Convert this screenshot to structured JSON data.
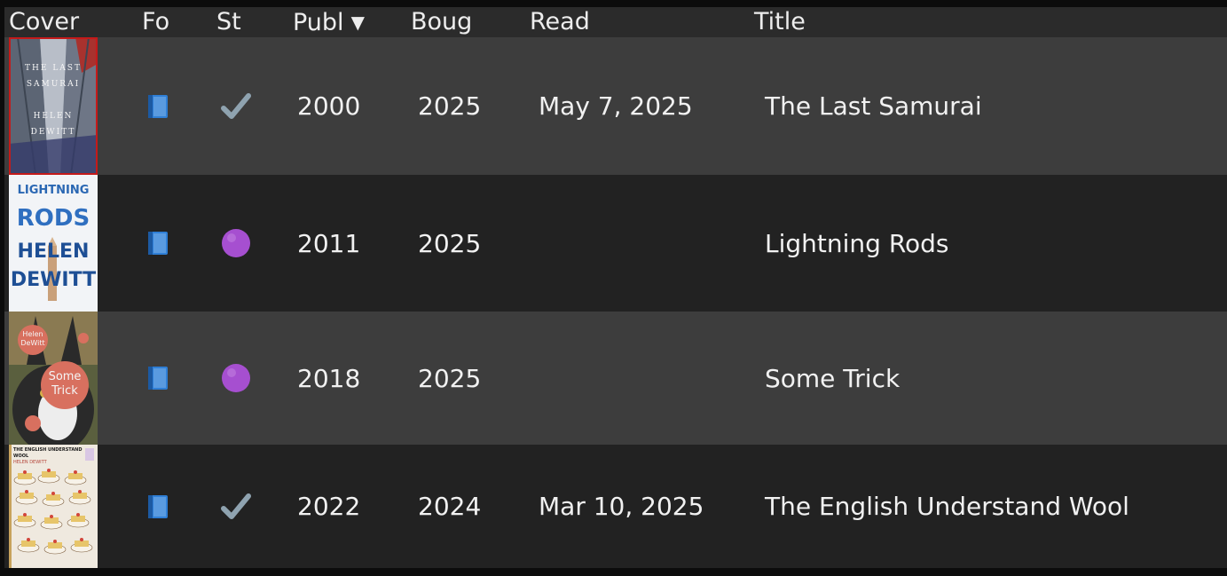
{
  "columns": {
    "cover": "Cover",
    "format": "Fo",
    "status": "St",
    "published": "Publ",
    "published_sort": "▼",
    "bought": "Boug",
    "read": "Read",
    "title": "Title"
  },
  "rows": [
    {
      "published": "2000",
      "bought": "2025",
      "read": "May 7, 2025",
      "title": "The Last Samurai",
      "format_icon": "blue-book",
      "status_icon": "check-mark",
      "cover_text": [
        "THE LAST",
        "SAMURAI",
        "HELEN",
        "DEWITT"
      ]
    },
    {
      "published": "2011",
      "bought": "2025",
      "read": "",
      "title": "Lightning Rods",
      "format_icon": "blue-book",
      "status_icon": "purple-circle",
      "cover_text": [
        "LIGHTNING",
        "RODS",
        "HELEN",
        "DEWITT"
      ]
    },
    {
      "published": "2018",
      "bought": "2025",
      "read": "",
      "title": "Some Trick",
      "format_icon": "blue-book",
      "status_icon": "purple-circle",
      "cover_text": [
        "Helen",
        "DeWitt",
        "Some",
        "Trick"
      ]
    },
    {
      "published": "2022",
      "bought": "2024",
      "read": "Mar 10, 2025",
      "title": "The English Understand Wool",
      "format_icon": "blue-book",
      "status_icon": "check-mark",
      "cover_text": [
        "THE ENGLISH UNDERSTAND",
        "WOOL",
        "HELEN DEWITT"
      ]
    }
  ],
  "colors": {
    "header_bg": "#2b2b2b",
    "row_light": "#3d3d3d",
    "row_dark": "#222222",
    "selection": "#c41a1a",
    "book_blue": "#2f7fd6",
    "status_purple": "#a64fd0",
    "check_gray": "#8fa3b0"
  }
}
